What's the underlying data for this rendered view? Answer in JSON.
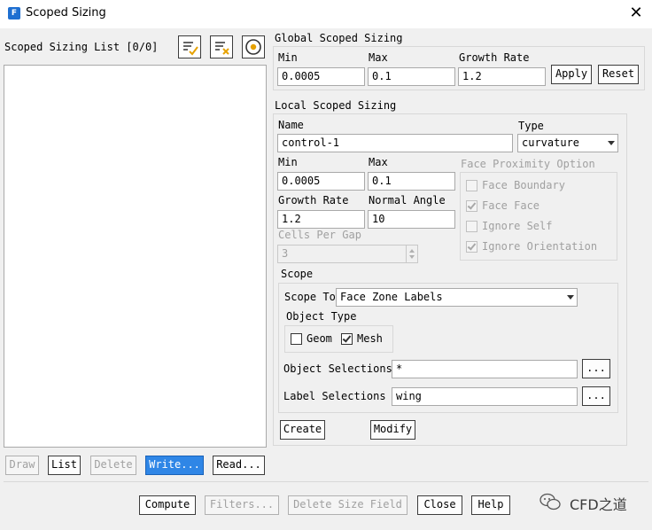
{
  "window": {
    "title": "Scoped Sizing",
    "app_icon_letter": "F"
  },
  "list_panel": {
    "title": "Scoped Sizing List [0/0]"
  },
  "global": {
    "header": "Global Scoped Sizing",
    "min_label": "Min",
    "min_value": "0.0005",
    "max_label": "Max",
    "max_value": "0.1",
    "growth_label": "Growth Rate",
    "growth_value": "1.2",
    "apply": "Apply",
    "reset": "Reset"
  },
  "local": {
    "header": "Local Scoped Sizing",
    "name_label": "Name",
    "name_value": "control-1",
    "type_label": "Type",
    "type_value": "curvature",
    "min_label": "Min",
    "min_value": "0.0005",
    "max_label": "Max",
    "max_value": "0.1",
    "growth_label": "Growth Rate",
    "growth_value": "1.2",
    "normal_angle_label": "Normal Angle",
    "normal_angle_value": "10",
    "cells_per_gap_label": "Cells Per Gap",
    "cells_per_gap_value": "3"
  },
  "proximity": {
    "header": "Face Proximity Option",
    "face_boundary": "Face Boundary",
    "face_face": "Face Face",
    "ignore_self": "Ignore Self",
    "ignore_orientation": "Ignore Orientation"
  },
  "scope": {
    "header": "Scope",
    "scope_to_label": "Scope To",
    "scope_to_value": "Face Zone Labels",
    "object_type_label": "Object Type",
    "geom": "Geom",
    "mesh": "Mesh",
    "object_selections_label": "Object Selections",
    "object_selections_value": "*",
    "label_selections_label": "Label Selections",
    "label_selections_value": "wing",
    "browse": "...",
    "create": "Create",
    "modify": "Modify"
  },
  "list_actions": {
    "draw": "Draw",
    "list": "List",
    "delete": "Delete",
    "write": "Write...",
    "read": "Read..."
  },
  "footer": {
    "compute": "Compute",
    "filters": "Filters...",
    "delete_size_field": "Delete Size Field",
    "close": "Close",
    "help": "Help"
  },
  "watermark": {
    "text": "CFD之道"
  }
}
